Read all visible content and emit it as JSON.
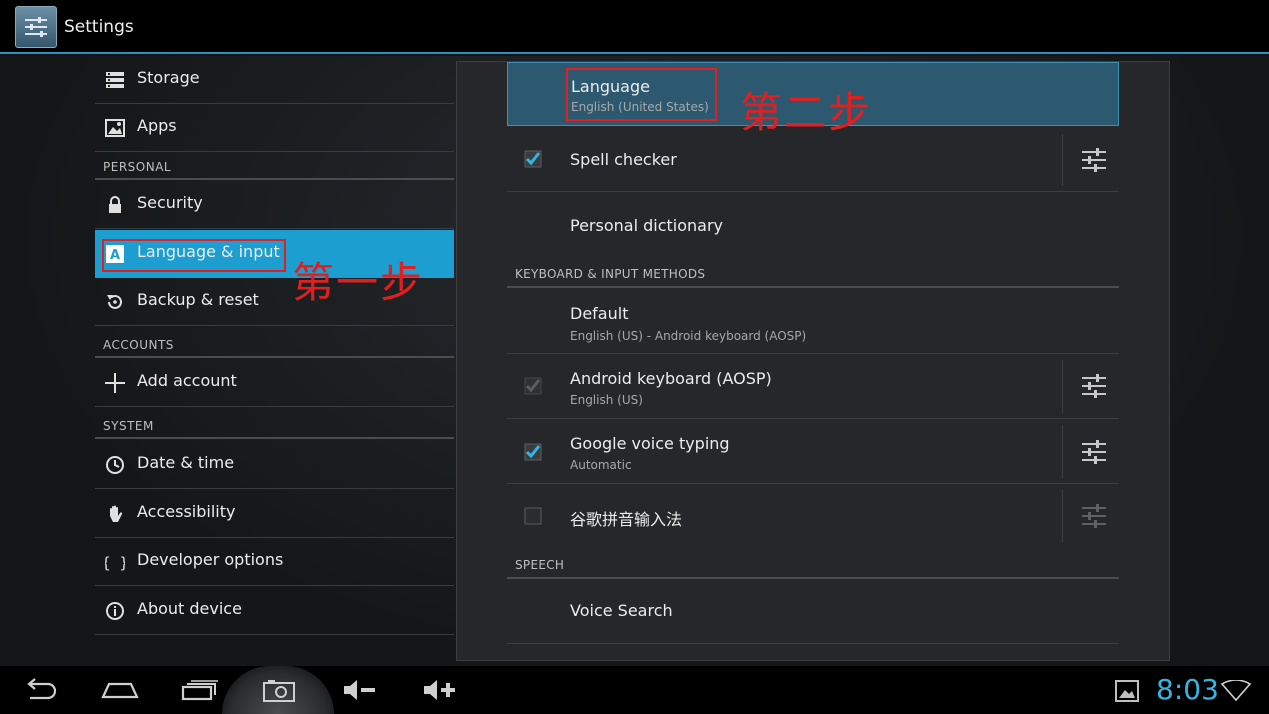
{
  "actionbar": {
    "title": "Settings",
    "icon": "settings-icon"
  },
  "left_list": {
    "items": [
      {
        "id": "storage",
        "label": "Storage",
        "icon": "storage-icon"
      },
      {
        "id": "apps",
        "label": "Apps",
        "icon": "apps-icon"
      },
      {
        "id": "personal_header",
        "label": "PERSONAL"
      },
      {
        "id": "security",
        "label": "Security",
        "icon": "lock-icon"
      },
      {
        "id": "language",
        "label": "Language & input",
        "icon": "language-icon",
        "selected": true
      },
      {
        "id": "backup",
        "label": "Backup & reset",
        "icon": "backup-icon"
      },
      {
        "id": "accounts_header",
        "label": "ACCOUNTS"
      },
      {
        "id": "add_account",
        "label": "Add account",
        "icon": "plus-icon"
      },
      {
        "id": "system_header",
        "label": "SYSTEM"
      },
      {
        "id": "date_time",
        "label": "Date & time",
        "icon": "clock-icon"
      },
      {
        "id": "accessibility",
        "label": "Accessibility",
        "icon": "hand-icon"
      },
      {
        "id": "developer",
        "label": "Developer options",
        "icon": "braces-icon"
      },
      {
        "id": "about",
        "label": "About device",
        "icon": "info-icon"
      }
    ]
  },
  "right_panel": {
    "language": {
      "title": "Language",
      "subtitle": "English (United States)"
    },
    "spell_checker": {
      "title": "Spell checker",
      "checked": true
    },
    "personal_dictionary": {
      "title": "Personal dictionary"
    },
    "keyboard_header": "KEYBOARD & INPUT METHODS",
    "default": {
      "title": "Default",
      "subtitle": "English (US) - Android keyboard (AOSP)"
    },
    "android_keyboard": {
      "title": "Android keyboard (AOSP)",
      "subtitle": "English (US)",
      "checked": true,
      "disabled": true
    },
    "google_voice": {
      "title": "Google voice typing",
      "subtitle": "Automatic",
      "checked": true
    },
    "pinyin": {
      "title": "谷歌拼音输入法",
      "checked": false
    },
    "speech_header": "SPEECH",
    "voice_search": {
      "title": "Voice Search"
    }
  },
  "annotations": {
    "step1": "第一步",
    "step2": "第二步"
  },
  "colors": {
    "accent": "#33b5e5",
    "selected": "#1c9fd0",
    "annotation": "#e02020"
  },
  "navbar": {
    "buttons": [
      "back-icon",
      "home-icon",
      "recent-apps-icon",
      "screenshot-icon",
      "volume-down-icon",
      "volume-up-icon"
    ],
    "clock": "8:03"
  }
}
